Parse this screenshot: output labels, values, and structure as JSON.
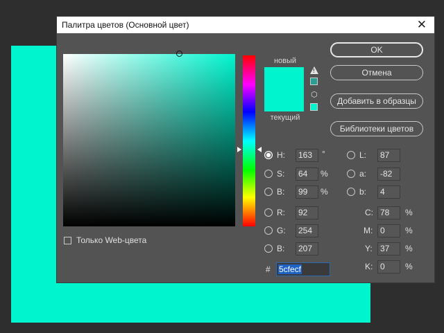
{
  "dialog": {
    "title": "Палитра цветов (Основной цвет)",
    "close_symbol": "✕"
  },
  "preview": {
    "new_label": "новый",
    "current_label": "текущий",
    "new_color": "#00f5cf",
    "current_color": "#00f5cf"
  },
  "buttons": {
    "ok": "OK",
    "cancel": "Отмена",
    "add_to_swatches": "Добавить в образцы",
    "color_libraries": "Библиотеки цветов"
  },
  "hsb": {
    "h": {
      "label": "H:",
      "value": "163",
      "unit": "°"
    },
    "s": {
      "label": "S:",
      "value": "64",
      "unit": "%"
    },
    "b": {
      "label": "B:",
      "value": "99",
      "unit": "%"
    }
  },
  "rgb": {
    "r": {
      "label": "R:",
      "value": "92"
    },
    "g": {
      "label": "G:",
      "value": "254"
    },
    "b": {
      "label": "B:",
      "value": "207"
    }
  },
  "lab": {
    "l": {
      "label": "L:",
      "value": "87"
    },
    "a": {
      "label": "a:",
      "value": "-82"
    },
    "b": {
      "label": "b:",
      "value": "4"
    }
  },
  "cmyk": {
    "c": {
      "label": "C:",
      "value": "78",
      "unit": "%"
    },
    "m": {
      "label": "M:",
      "value": "0",
      "unit": "%"
    },
    "y": {
      "label": "Y:",
      "value": "37",
      "unit": "%"
    },
    "k": {
      "label": "K:",
      "value": "0",
      "unit": "%"
    }
  },
  "hex": {
    "label": "#",
    "value": "5cfecf"
  },
  "web_only": {
    "label": "Только Web-цвета",
    "checked": false
  },
  "colors": {
    "dialog_bg": "#535353",
    "accent": "#00f5cf",
    "gamut_swatch": "#2a9e93"
  }
}
